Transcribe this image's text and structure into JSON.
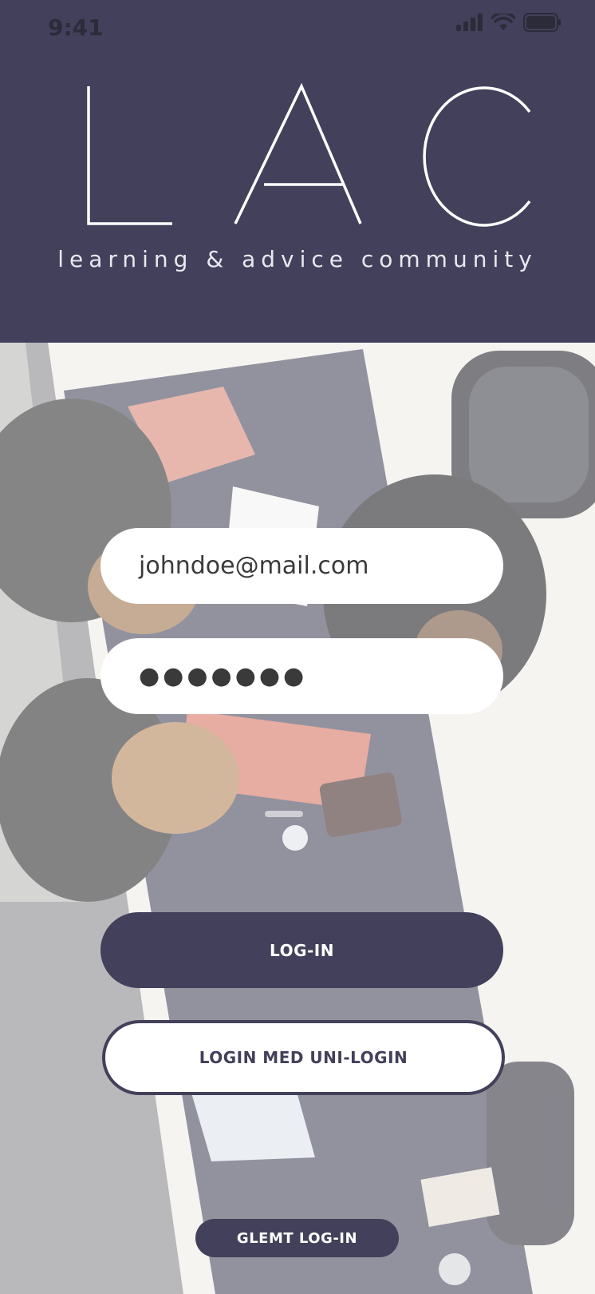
{
  "status_bar": {
    "time": "9:41"
  },
  "brand": {
    "logo_letters": "LAC",
    "tagline": "learning & advice community"
  },
  "login_form": {
    "email_value": "johndoe@mail.com",
    "password_value": "●●●●●●●"
  },
  "buttons": {
    "login": "LOG-IN",
    "uni_login": "LOGIN MED UNI-LOGIN",
    "forgot": "GLEMT LOG-IN"
  },
  "colors": {
    "primary": "#42405a",
    "background": "#ffffff"
  },
  "icons": [
    "signal-icon",
    "wifi-icon",
    "battery-icon"
  ]
}
